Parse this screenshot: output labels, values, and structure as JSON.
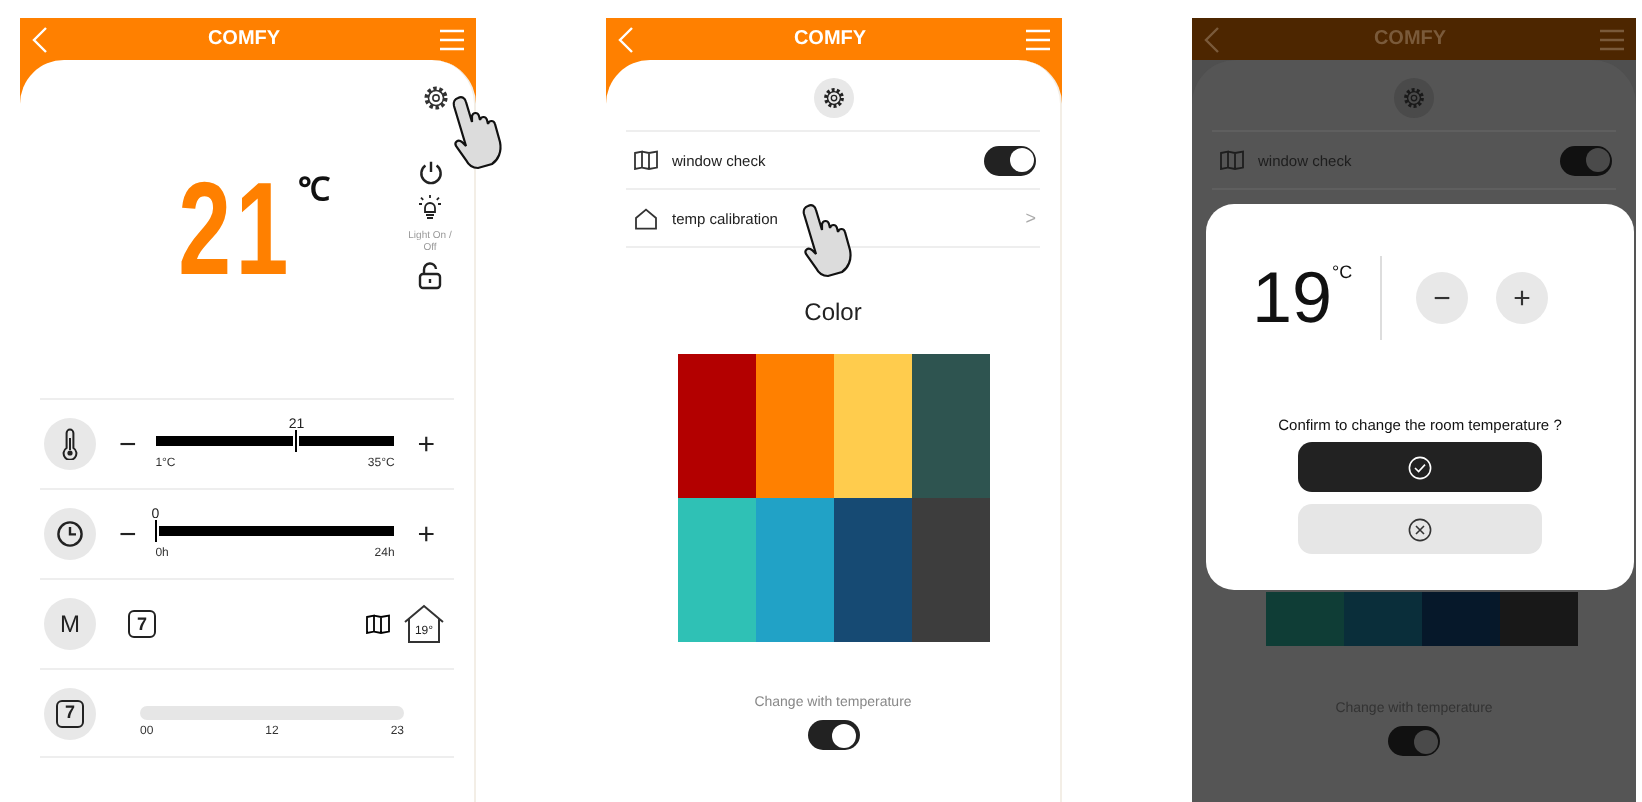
{
  "main_screen": {
    "title": "COMFY",
    "temperature": "21",
    "unit": "℃",
    "light_label": "Light On / Off",
    "sliders": [
      {
        "kind": "temperature",
        "minus": "−",
        "plus": "+",
        "value": "21",
        "min_label": "1°C",
        "max_label": "35°C",
        "level": 0.59
      },
      {
        "kind": "timer",
        "minus": "−",
        "plus": "+",
        "value": "0",
        "min_label": "0h",
        "max_label": "24h",
        "level": 0
      }
    ],
    "mode": {
      "label": "M",
      "calendar_day": "7",
      "house_temp": "19°"
    },
    "schedule": {
      "calendar_day": "7",
      "ticks": [
        "00",
        "12",
        "23"
      ]
    }
  },
  "settings_screen": {
    "title": "COMFY",
    "rows": [
      {
        "kind": "toggle",
        "label": "window check",
        "on": true
      },
      {
        "kind": "link",
        "label": "temp calibration",
        "arrow": ">"
      }
    ],
    "color_title": "Color",
    "swatches": [
      {
        "color": "#b30000"
      },
      {
        "color": "#ff8000"
      },
      {
        "color": "#ffcc4d"
      },
      {
        "color": "#2e5450"
      },
      {
        "color": "#2fc1b5"
      },
      {
        "color": "#21a2c6"
      },
      {
        "color": "#164a73"
      },
      {
        "color": "#3d3d3d"
      }
    ],
    "change_label": "Change with temperature",
    "change_toggle_on": true
  },
  "confirm_screen": {
    "title": "COMFY",
    "rows": [
      {
        "kind": "toggle",
        "label": "window check",
        "on": true
      }
    ],
    "swatches": [
      {
        "color": "#0f3d36"
      },
      {
        "color": "#0a2e3a"
      },
      {
        "color": "#06182a"
      },
      {
        "color": "#181818"
      }
    ],
    "change_label": "Change with temperature",
    "change_toggle_on": true,
    "dialog": {
      "temperature": "19",
      "unit": "°C",
      "minus": "−",
      "plus": "+",
      "question": "Confirm to change the room temperature ?"
    }
  }
}
